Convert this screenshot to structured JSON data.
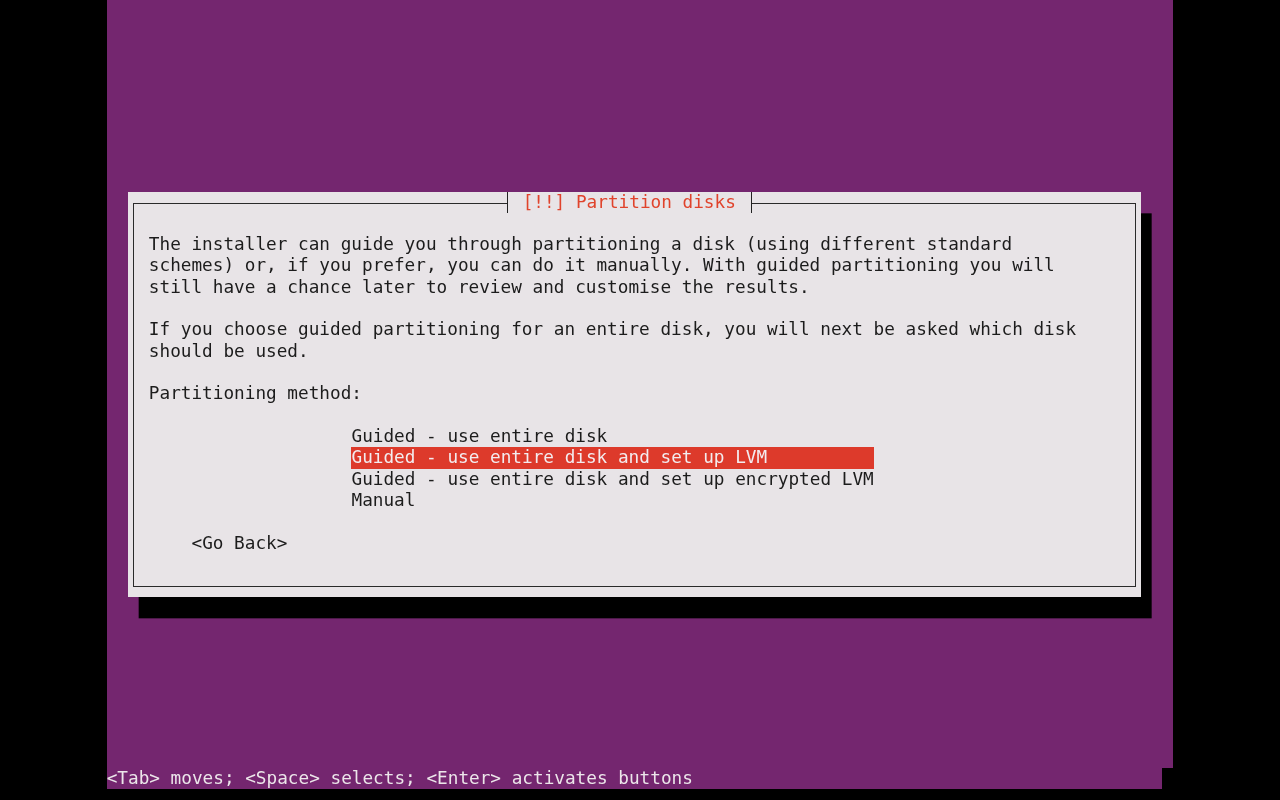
{
  "dialog": {
    "title": "[!!] Partition disks",
    "paragraphs": [
      "The installer can guide you through partitioning a disk (using different standard schemes) or, if you prefer, you can do it manually. With guided partitioning you will still have a chance later to review and customise the results.",
      "If you choose guided partitioning for an entire disk, you will next be asked which disk should be used."
    ],
    "prompt": "Partitioning method:",
    "options": [
      {
        "label": "Guided - use entire disk",
        "selected": false
      },
      {
        "label": "Guided - use entire disk and set up LVM",
        "selected": true
      },
      {
        "label": "Guided - use entire disk and set up encrypted LVM",
        "selected": false
      },
      {
        "label": "Manual",
        "selected": false
      }
    ],
    "buttons": [
      {
        "label": "<Go Back>"
      }
    ]
  },
  "status_bar": {
    "text": "<Tab> moves; <Space> selects; <Enter> activates buttons"
  }
}
